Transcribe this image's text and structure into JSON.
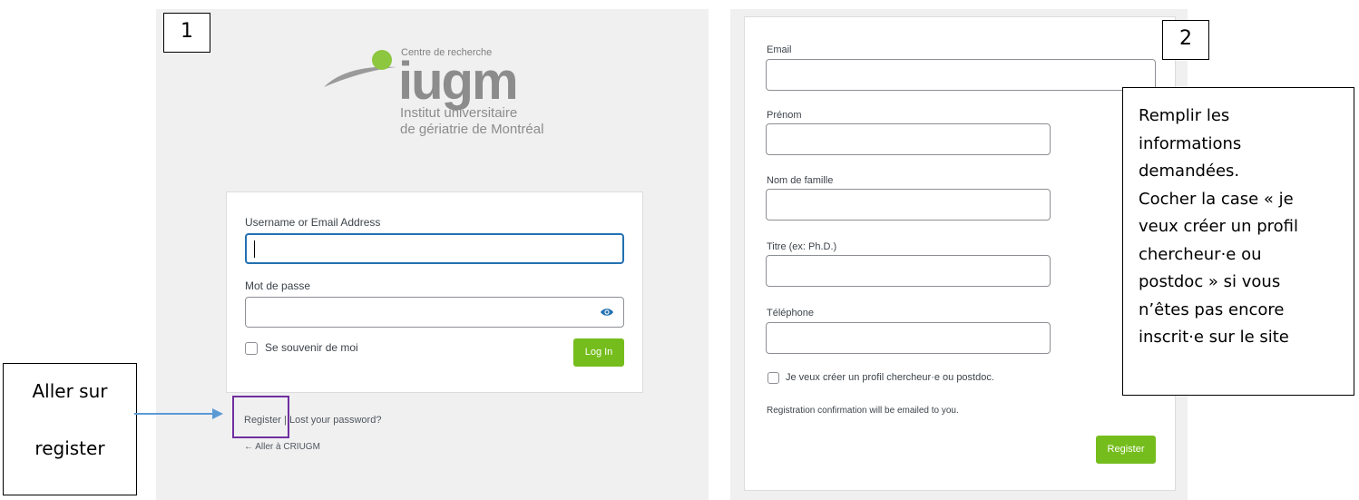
{
  "steps": {
    "one": "1",
    "two": "2"
  },
  "logo": {
    "small": "Centre de recherche",
    "big": "iugm",
    "line1": "Institut universitaire",
    "line2": "de gériatrie de Montréal"
  },
  "login": {
    "username_label": "Username or Email Address",
    "username_value": "",
    "password_label": "Mot de passe",
    "password_value": "",
    "remember_label": "Se souvenir de moi",
    "login_button": "Log In",
    "register_link": "Register",
    "separator": " | ",
    "lost_password_link": "Lost your password?",
    "back_link": "← Aller à CRIUGM"
  },
  "callout_left": {
    "line1": "Aller sur",
    "line2": "register"
  },
  "register": {
    "email_label": "Email",
    "firstname_label": "Prénom",
    "lastname_label": "Nom de famille",
    "title_label": "Titre (ex: Ph.D.)",
    "phone_label": "Téléphone",
    "checkbox_label": "Je veux créer un profil chercheur·e ou postdoc.",
    "note": "Registration confirmation will be emailed to you.",
    "register_button": "Register"
  },
  "callout_right": {
    "lines": [
      "Remplir les",
      "informations",
      "demandées.",
      "Cocher la case « je",
      "veux créer un profil",
      "chercheur·e ou",
      "postdoc » si vous",
      "n’êtes pas encore",
      "inscrit·e sur le site"
    ]
  },
  "colors": {
    "accent_green": "#75bd1c",
    "logo_green": "#8dc63f",
    "focus_blue": "#2271b1",
    "highlight_purple": "#7030a0",
    "arrow_blue": "#5b9bd5"
  }
}
